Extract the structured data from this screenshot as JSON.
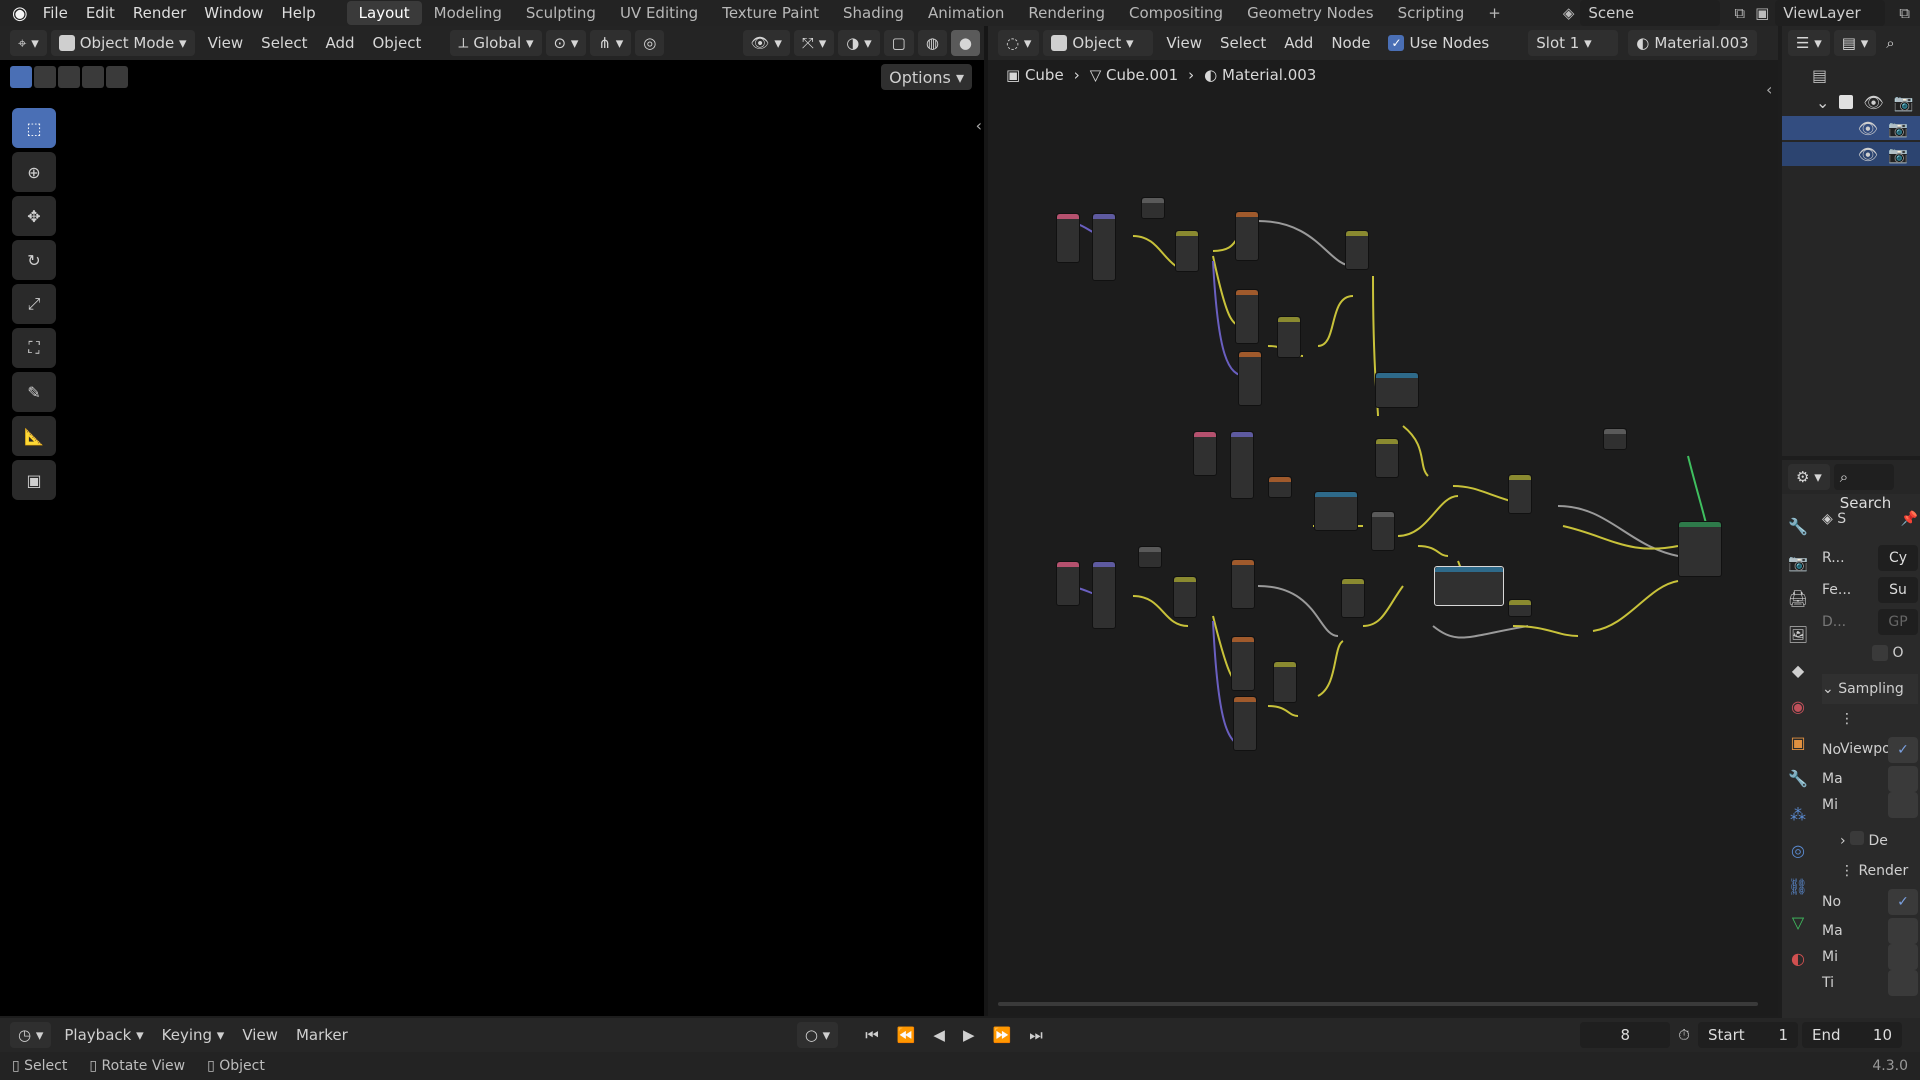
{
  "topbar": {
    "menus": [
      "File",
      "Edit",
      "Render",
      "Window",
      "Help"
    ],
    "workspaces": [
      "Layout",
      "Modeling",
      "Sculpting",
      "UV Editing",
      "Texture Paint",
      "Shading",
      "Animation",
      "Rendering",
      "Compositing",
      "Geometry Nodes",
      "Scripting"
    ],
    "active_workspace": "Layout",
    "scene": "Scene",
    "view_layer": "ViewLayer"
  },
  "viewport": {
    "mode": "Object Mode",
    "menus": [
      "View",
      "Select",
      "Add",
      "Object"
    ],
    "orientation": "Global",
    "options": "Options"
  },
  "node_editor": {
    "type": "Object",
    "menus": [
      "View",
      "Select",
      "Add",
      "Node"
    ],
    "use_nodes": "Use Nodes",
    "slot": "Slot 1",
    "material": "Material.003",
    "breadcrumb": [
      "Cube",
      "Cube.001",
      "Material.003"
    ]
  },
  "properties": {
    "search": "Search",
    "section_sampling": "Sampling",
    "viewport": "Viewport",
    "render": "Render",
    "rows": [
      "R...",
      "Fe...",
      "D..."
    ],
    "values": [
      "Cy",
      "Su",
      "GP"
    ],
    "short_labels": [
      "S",
      "O",
      "No",
      "Ma",
      "Mi",
      "De",
      "No",
      "Ma",
      "Mi",
      "Ti"
    ]
  },
  "timeline": {
    "menus": [
      "Playback",
      "Keying",
      "View",
      "Marker"
    ],
    "current_frame": "8",
    "start_label": "Start",
    "start": "1",
    "end_label": "End",
    "end": "10"
  },
  "status": {
    "items": [
      "Select",
      "Rotate View",
      "Object"
    ],
    "version": "4.3.0"
  },
  "colors": {
    "accent": "#4a6fb5",
    "disk": "#c98a4b",
    "wire_yellow": "#c8c23a",
    "wire_gray": "#9a9a9a",
    "wire_purple": "#6a5fc0",
    "wire_green": "#3fbf5f"
  }
}
